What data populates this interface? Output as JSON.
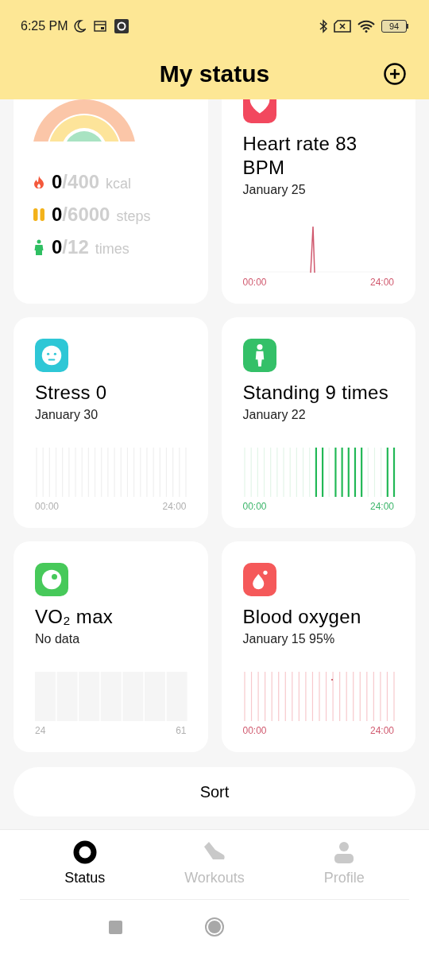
{
  "status_bar": {
    "time": "6:25 PM",
    "battery": "94"
  },
  "header": {
    "title": "My status"
  },
  "summary": {
    "stats": [
      {
        "kind": "calories",
        "value": "0",
        "goal": "/400",
        "unit": "kcal"
      },
      {
        "kind": "steps",
        "value": "0",
        "goal": "/6000",
        "unit": "steps"
      },
      {
        "kind": "standing",
        "value": "0",
        "goal": "/12",
        "unit": "times"
      }
    ]
  },
  "cards": [
    {
      "kind": "heart_rate",
      "title": "Heart rate 83 BPM",
      "subtitle": "January 25",
      "axis_start": "00:00",
      "axis_end": "24:00"
    },
    {
      "kind": "stress",
      "title": "Stress 0",
      "subtitle": "January 30",
      "axis_start": "00:00",
      "axis_end": "24:00"
    },
    {
      "kind": "standing",
      "title": "Standing 9 times",
      "subtitle": "January 22",
      "axis_start": "00:00",
      "axis_end": "24:00"
    },
    {
      "kind": "vo2",
      "title": "VO₂ max",
      "subtitle": "No data",
      "axis_start": "24",
      "axis_end": "61"
    },
    {
      "kind": "blood_oxygen",
      "title": "Blood oxygen",
      "subtitle": "January 15 95%",
      "axis_start": "00:00",
      "axis_end": "24:00"
    }
  ],
  "sort_button": "Sort",
  "bottom_nav": [
    {
      "kind": "status",
      "label": "Status",
      "selected": true
    },
    {
      "kind": "workouts",
      "label": "Workouts",
      "selected": false
    },
    {
      "kind": "profile",
      "label": "Profile",
      "selected": false
    }
  ]
}
